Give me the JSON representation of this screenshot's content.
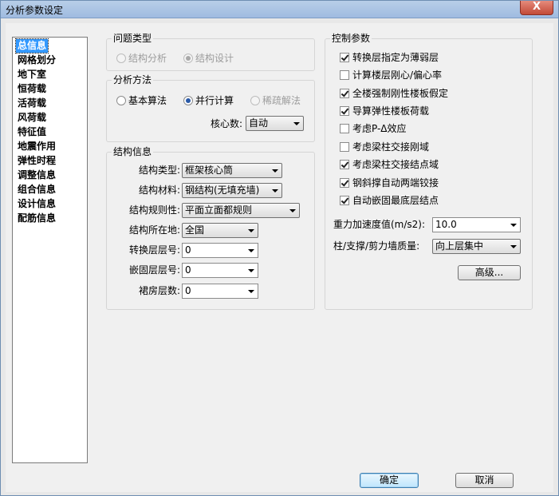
{
  "window": {
    "title": "分析参数设定",
    "close_label": "X"
  },
  "nav": {
    "items": [
      "总信息",
      "网格划分",
      "地下室",
      "恒荷载",
      "活荷载",
      "风荷载",
      "特征值",
      "地震作用",
      "弹性时程",
      "调整信息",
      "组合信息",
      "设计信息",
      "配筋信息"
    ],
    "selected": "总信息"
  },
  "problem_type": {
    "title": "问题类型",
    "options": [
      "结构分析",
      "结构设计"
    ]
  },
  "analysis_method": {
    "title": "分析方法",
    "options": [
      "基本算法",
      "并行计算",
      "稀疏解法"
    ],
    "cores_label": "核心数:",
    "cores_value": "自动"
  },
  "structure_info": {
    "title": "结构信息",
    "fields": [
      {
        "label": "结构类型:",
        "value": "框架核心筒"
      },
      {
        "label": "结构材料:",
        "value": "钢结构(无填充墙)"
      },
      {
        "label": "结构规则性:",
        "value": "平面立面都规则"
      },
      {
        "label": "结构所在地:",
        "value": "全国"
      },
      {
        "label": "转换层层号:",
        "value": "0"
      },
      {
        "label": "嵌固层层号:",
        "value": "0"
      },
      {
        "label": "裙房层数:",
        "value": "0"
      }
    ]
  },
  "control": {
    "title": "控制参数",
    "checks": [
      {
        "label": "转换层指定为薄弱层",
        "checked": true
      },
      {
        "label": "计算楼层刚心/偏心率",
        "checked": false
      },
      {
        "label": "全楼强制刚性楼板假定",
        "checked": true
      },
      {
        "label": "导算弹性楼板荷载",
        "checked": true
      },
      {
        "label": "考虑P-Δ效应",
        "checked": false
      },
      {
        "label": "考虑梁柱交接刚域",
        "checked": false
      },
      {
        "label": "考虑梁柱交接结点域",
        "checked": true
      },
      {
        "label": "钢斜撑自动两端铰接",
        "checked": true
      },
      {
        "label": "自动嵌固最底层结点",
        "checked": true
      }
    ],
    "gravity_label": "重力加速度值(m/s2):",
    "gravity_value": "10.0",
    "mass_label": "柱/支撑/剪力墙质量:",
    "mass_value": "向上层集中",
    "advanced_label": "高级..."
  },
  "footer": {
    "ok_label": "确定",
    "cancel_label": "取消"
  }
}
